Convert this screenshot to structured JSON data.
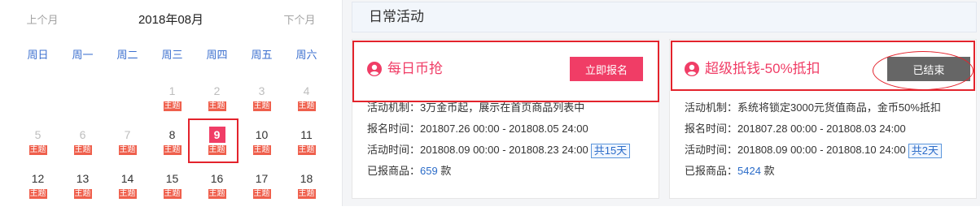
{
  "calendar": {
    "prev_label": "上个月",
    "title": "2018年08月",
    "next_label": "下个月",
    "weekdays": [
      "周日",
      "周一",
      "周二",
      "周三",
      "周四",
      "周五",
      "周六"
    ],
    "weeks": [
      [
        null,
        null,
        null,
        {
          "day": 1,
          "disabled": true,
          "badge": "主题"
        },
        {
          "day": 2,
          "disabled": true,
          "badge": "主题"
        },
        {
          "day": 3,
          "disabled": true,
          "badge": "主题"
        },
        {
          "day": 4,
          "disabled": true,
          "badge": "主题"
        }
      ],
      [
        {
          "day": 5,
          "disabled": true,
          "badge": "主题"
        },
        {
          "day": 6,
          "disabled": true,
          "badge": "主题"
        },
        {
          "day": 7,
          "disabled": true,
          "badge": "主题"
        },
        {
          "day": 8,
          "badge": "主题"
        },
        {
          "day": 9,
          "selected": true,
          "badge": "主题"
        },
        {
          "day": 10,
          "badge": "主题"
        },
        {
          "day": 11,
          "badge": "主题"
        }
      ],
      [
        {
          "day": 12,
          "badge": "主题"
        },
        {
          "day": 13,
          "badge": "主题"
        },
        {
          "day": 14,
          "badge": "主题"
        },
        {
          "day": 15,
          "badge": "主题"
        },
        {
          "day": 16,
          "badge": "主题"
        },
        {
          "day": 17,
          "badge": "主题"
        },
        {
          "day": 18,
          "badge": "主题"
        }
      ]
    ]
  },
  "activities": {
    "title": "日常活动",
    "labels": {
      "mechanism": "活动机制：",
      "signup": "报名时间：",
      "activity": "活动时间：",
      "registered": "已报商品：",
      "unit": "款"
    },
    "cards": [
      {
        "icon": "user-icon",
        "title": "每日币抢",
        "button_label": "立即报名",
        "button_state": "open",
        "mechanism": "3万金币起，展示在首页商品列表中",
        "signup_time": "201807.26 00:00 - 201808.05 24:00",
        "activity_time": "201808.09 00:00 - 201808.23 24:00",
        "duration": "共15天",
        "registered_count": "659"
      },
      {
        "icon": "user-icon",
        "title": "超级抵钱-50%抵扣",
        "button_label": "已结束",
        "button_state": "ended",
        "mechanism": "系统将锁定3000元货值商品，金币50%抵扣",
        "signup_time": "201807.28 00:00 - 201808.03 24:00",
        "activity_time": "201808.09 00:00 - 201808.10 24:00",
        "duration": "共2天",
        "registered_count": "5424"
      }
    ]
  },
  "colors": {
    "accent": "#f03d66",
    "badge": "#ef5f4c",
    "weekday": "#3b6fcf",
    "link": "#2a6bc8",
    "ended_button": "#666666",
    "annotation": "#e3232c"
  }
}
